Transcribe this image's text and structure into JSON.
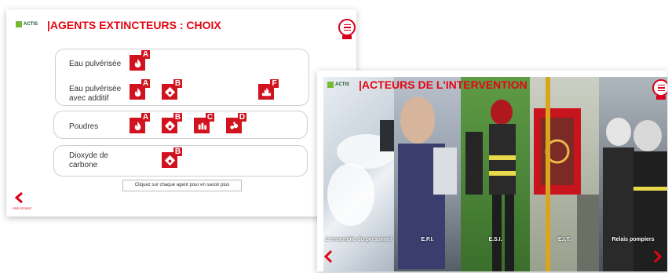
{
  "slide1": {
    "logo_text": "ACTIS",
    "title": "|AGENTS EXTINCTEURS : CHOIX",
    "groups": [
      {
        "label": "Eau pulvérisée",
        "agents": [
          "A"
        ]
      },
      {
        "label": "Eau pulvérisée avec additif",
        "agents": [
          "A",
          "B",
          "F"
        ]
      },
      {
        "label": "Poudres",
        "agents": [
          "A",
          "B",
          "C",
          "D"
        ]
      },
      {
        "label": "Dioxyde de carbone",
        "agents": [
          "B"
        ]
      }
    ],
    "tooltip": "Cliquez sur chaque agent pour en savoir plus",
    "back_label": "PRÉCÉDENT",
    "back_icon": "chevron-left-icon"
  },
  "slide2": {
    "logo_text": "ACTIS",
    "title": "|ACTEURS DE L'INTERVENTION",
    "panels": [
      {
        "caption": "L'ensemble du personnel"
      },
      {
        "caption": "E.P.I."
      },
      {
        "caption": "E.S.I."
      },
      {
        "caption": "E.I.T."
      },
      {
        "caption": "Relais pompiers"
      }
    ],
    "prev_icon": "chevron-left-icon",
    "next_icon": "chevron-right-icon"
  },
  "colors": {
    "accent": "#e30613",
    "agent_red": "#d1131f"
  }
}
